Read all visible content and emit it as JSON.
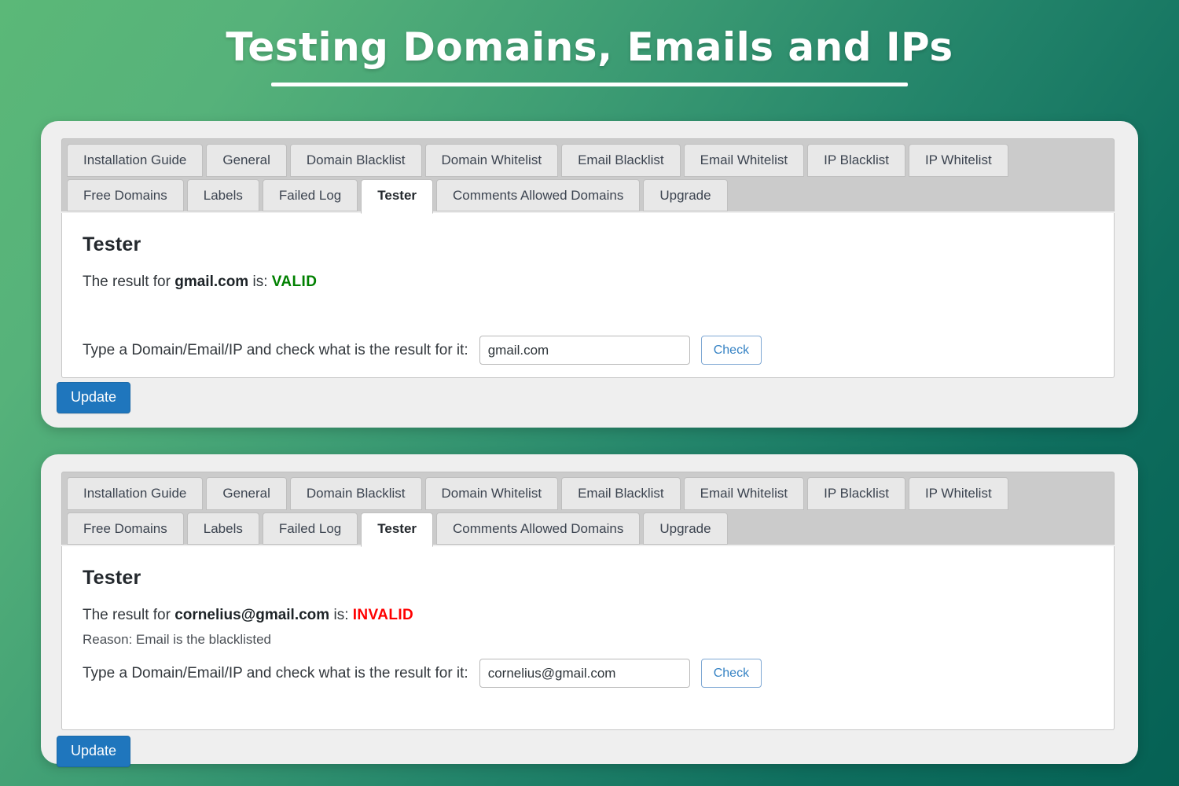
{
  "header": {
    "title": "Testing Domains, Emails and IPs"
  },
  "tabs": {
    "row1": [
      "Installation Guide",
      "General",
      "Domain Blacklist",
      "Domain Whitelist",
      "Email Blacklist",
      "Email Whitelist",
      "IP Blacklist",
      "IP Whitelist"
    ],
    "row2": [
      "Free Domains",
      "Labels",
      "Failed Log",
      "Tester",
      "Comments Allowed Domains",
      "Upgrade"
    ],
    "active": "Tester"
  },
  "panel1": {
    "section_title": "Tester",
    "result_prefix": "The result for ",
    "result_target": "gmail.com",
    "result_middle": " is: ",
    "result_verdict": "VALID",
    "verdict_color": "#008000",
    "check_label": "Type a Domain/Email/IP and check what is the result for it:",
    "input_value": "gmail.com",
    "input_placeholder": "",
    "check_button": "Check",
    "update_button": "Update"
  },
  "panel2": {
    "section_title": "Tester",
    "result_prefix": "The result for ",
    "result_target": "cornelius@gmail.com",
    "result_middle": " is: ",
    "result_verdict": "INVALID",
    "verdict_color": "#ff0000",
    "reason": "Reason: Email is the blacklisted",
    "check_label": "Type a Domain/Email/IP and check what is the result for it:",
    "input_value": "cornelius@gmail.com",
    "input_placeholder": "",
    "check_button": "Check",
    "update_button": "Update"
  },
  "theme": {
    "background_start": "#5bb878",
    "background_end": "#056154",
    "card_bg": "#efefef",
    "tabstrip_bg": "#cbcbcb",
    "primary_button": "#1f76bd",
    "link_blue": "#3582c4"
  }
}
